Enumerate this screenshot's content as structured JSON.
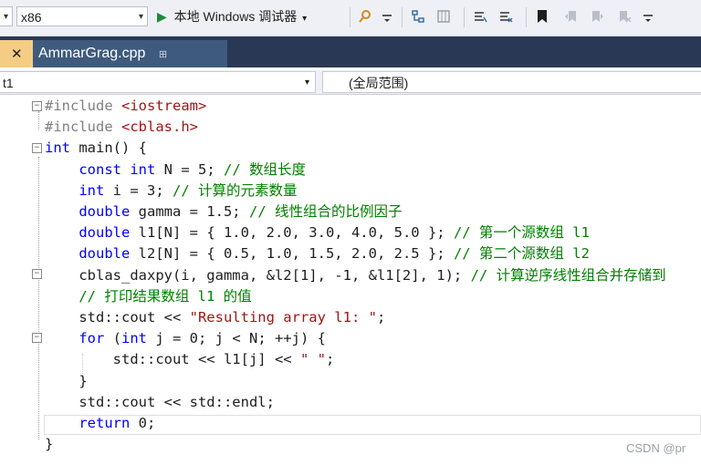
{
  "toolbar": {
    "platform_combo": "x86",
    "run_button_label": "本地 Windows 调试器",
    "run_arrow": "▶",
    "dropdown_arrow": "▾"
  },
  "tabs": [
    {
      "label": "AmmarGrag.cpp",
      "pin": "⊞",
      "close": "✕"
    }
  ],
  "navbar": {
    "left_combo": "t1",
    "scope_combo": "(全局范围)"
  },
  "code": {
    "lines": [
      {
        "parts": [
          [
            "pp",
            "#include "
          ],
          [
            "inc",
            "<iostream>"
          ]
        ]
      },
      {
        "parts": [
          [
            "pp",
            "#include "
          ],
          [
            "inc",
            "<cblas.h>"
          ]
        ]
      },
      {
        "parts": [
          [
            "kw",
            "int"
          ],
          [
            "t",
            " main() {"
          ]
        ]
      },
      {
        "parts": [
          [
            "t",
            "    "
          ],
          [
            "kw",
            "const int"
          ],
          [
            "t",
            " N = 5; "
          ],
          [
            "cm",
            "// 数组长度"
          ]
        ]
      },
      {
        "parts": [
          [
            "t",
            "    "
          ],
          [
            "kw",
            "int"
          ],
          [
            "t",
            " i = 3; "
          ],
          [
            "cm",
            "// 计算的元素数量"
          ]
        ]
      },
      {
        "parts": [
          [
            "t",
            "    "
          ],
          [
            "kw",
            "double"
          ],
          [
            "t",
            " gamma = 1.5; "
          ],
          [
            "cm",
            "// 线性组合的比例因子"
          ]
        ]
      },
      {
        "parts": [
          [
            "t",
            "    "
          ],
          [
            "kw",
            "double"
          ],
          [
            "t",
            " l1[N] = { 1.0, 2.0, 3.0, 4.0, 5.0 }; "
          ],
          [
            "cm",
            "// 第一个源数组 l1"
          ]
        ]
      },
      {
        "parts": [
          [
            "t",
            "    "
          ],
          [
            "kw",
            "double"
          ],
          [
            "t",
            " l2[N] = { 0.5, 1.0, 1.5, 2.0, 2.5 }; "
          ],
          [
            "cm",
            "// 第二个源数组 l2"
          ]
        ]
      },
      {
        "parts": [
          [
            "t",
            "    cblas_daxpy(i, gamma, &l2[1], -1, &l1[2], 1); "
          ],
          [
            "cm",
            "// 计算逆序线性组合并存储到"
          ]
        ]
      },
      {
        "parts": [
          [
            "t",
            "    "
          ],
          [
            "cm",
            "// 打印结果数组 l1 的值"
          ]
        ]
      },
      {
        "parts": [
          [
            "t",
            "    std::cout << "
          ],
          [
            "str",
            "\"Resulting array l1: \""
          ],
          [
            "t",
            ";"
          ]
        ]
      },
      {
        "parts": [
          [
            "t",
            "    "
          ],
          [
            "kw",
            "for"
          ],
          [
            "t",
            " ("
          ],
          [
            "kw",
            "int"
          ],
          [
            "t",
            " j = 0; j < N; ++j) {"
          ]
        ]
      },
      {
        "parts": [
          [
            "t",
            "        std::cout << l1[j] << "
          ],
          [
            "str",
            "\" \""
          ],
          [
            "t",
            ";"
          ]
        ]
      },
      {
        "parts": [
          [
            "t",
            "    }"
          ]
        ]
      },
      {
        "parts": [
          [
            "t",
            "    std::cout << std::endl;"
          ]
        ]
      },
      {
        "parts": [
          [
            "t",
            "    "
          ],
          [
            "kw",
            "return"
          ],
          [
            "t",
            " 0;"
          ]
        ]
      },
      {
        "parts": [
          [
            "t",
            "}"
          ]
        ]
      }
    ]
  },
  "watermark": "CSDN @pr"
}
